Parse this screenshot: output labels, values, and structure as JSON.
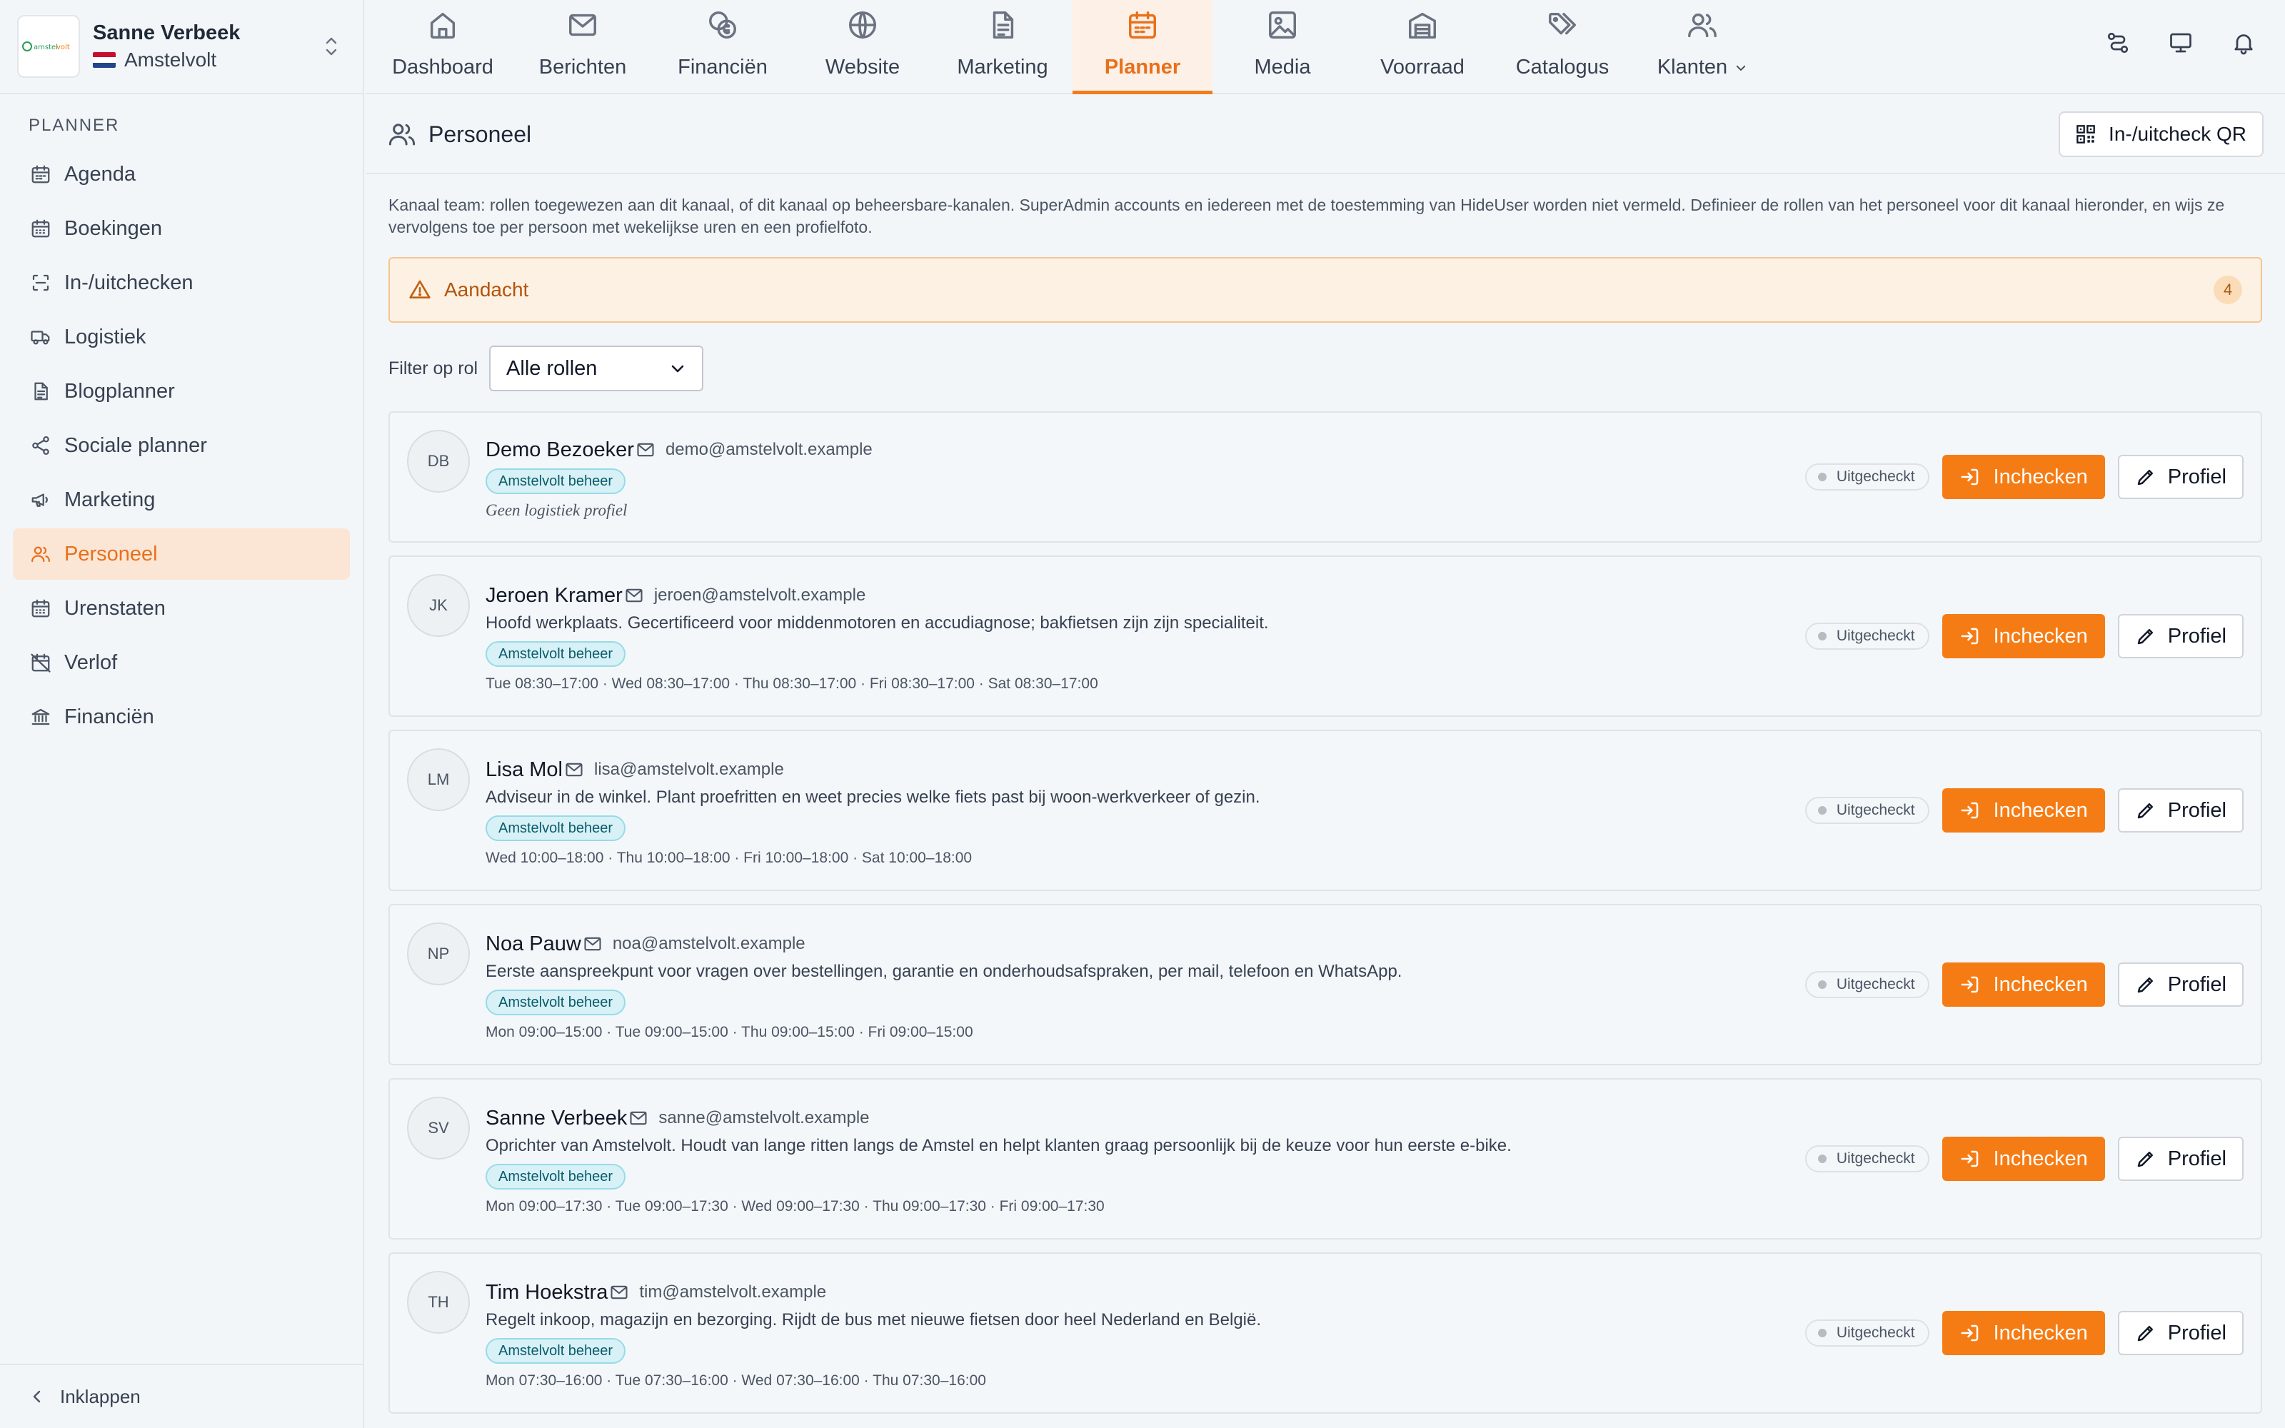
{
  "account": {
    "name": "Sanne Verbeek",
    "channel": "Amstelvolt",
    "logo_text": "amstelvolt"
  },
  "sidebar": {
    "section_title": "PLANNER",
    "items": [
      {
        "label": "Agenda",
        "icon": "calendar-icon"
      },
      {
        "label": "Boekingen",
        "icon": "calendar-grid-icon"
      },
      {
        "label": "In-/uitchecken",
        "icon": "scan-icon"
      },
      {
        "label": "Logistiek",
        "icon": "truck-icon"
      },
      {
        "label": "Blogplanner",
        "icon": "document-icon"
      },
      {
        "label": "Sociale planner",
        "icon": "share-icon"
      },
      {
        "label": "Marketing",
        "icon": "megaphone-icon"
      },
      {
        "label": "Personeel",
        "icon": "users-icon",
        "active": true
      },
      {
        "label": "Urenstaten",
        "icon": "calendar-grid-icon"
      },
      {
        "label": "Verlof",
        "icon": "calendar-off-icon"
      },
      {
        "label": "Financiën",
        "icon": "bank-icon"
      }
    ],
    "collapse_label": "Inklappen"
  },
  "topnav": {
    "tabs": [
      {
        "label": "Dashboard",
        "icon": "home-icon"
      },
      {
        "label": "Berichten",
        "icon": "mail-icon"
      },
      {
        "label": "Financiën",
        "icon": "coins-icon"
      },
      {
        "label": "Website",
        "icon": "globe-icon"
      },
      {
        "label": "Marketing",
        "icon": "document-icon"
      },
      {
        "label": "Planner",
        "icon": "calendar-icon",
        "active": true
      },
      {
        "label": "Media",
        "icon": "image-icon"
      },
      {
        "label": "Voorraad",
        "icon": "warehouse-icon"
      },
      {
        "label": "Catalogus",
        "icon": "tags-icon"
      },
      {
        "label": "Klanten",
        "icon": "users-icon"
      }
    ]
  },
  "page": {
    "title": "Personeel",
    "qr_button": "In-/uitcheck QR",
    "intro": "Kanaal team: rollen toegewezen aan dit kanaal, of dit kanaal op beheersbare-kanalen. SuperAdmin accounts en iedereen met de toestemming van HideUser worden niet vermeld. Definieer de rollen van het personeel voor dit kanaal hieronder, en wijs ze vervolgens toe per persoon met wekelijkse uren en een profielfoto.",
    "attention_label": "Aandacht",
    "attention_count": "4",
    "filter_label": "Filter op rol",
    "filter_value": "Alle rollen"
  },
  "staff_labels": {
    "status": "Uitgecheckt",
    "checkin": "Inchecken",
    "profile": "Profiel"
  },
  "staff": [
    {
      "initials": "DB",
      "name": "Demo Bezoeker",
      "email": "demo@amstelvolt.example",
      "description": "",
      "role": "Amstelvolt beheer",
      "note": "Geen logistiek profiel",
      "hours": ""
    },
    {
      "initials": "JK",
      "name": "Jeroen Kramer",
      "email": "jeroen@amstelvolt.example",
      "description": "Hoofd werkplaats. Gecertificeerd voor middenmotoren en accudiagnose; bakfietsen zijn zijn specialiteit.",
      "role": "Amstelvolt beheer",
      "note": "",
      "hours": "Tue 08:30–17:00 · Wed 08:30–17:00 · Thu 08:30–17:00 · Fri 08:30–17:00 · Sat 08:30–17:00"
    },
    {
      "initials": "LM",
      "name": "Lisa Mol",
      "email": "lisa@amstelvolt.example",
      "description": "Adviseur in de winkel. Plant proefritten en weet precies welke fiets past bij woon-werkverkeer of gezin.",
      "role": "Amstelvolt beheer",
      "note": "",
      "hours": "Wed 10:00–18:00 · Thu 10:00–18:00 · Fri 10:00–18:00 · Sat 10:00–18:00"
    },
    {
      "initials": "NP",
      "name": "Noa Pauw",
      "email": "noa@amstelvolt.example",
      "description": "Eerste aanspreekpunt voor vragen over bestellingen, garantie en onderhoudsafspraken, per mail, telefoon en WhatsApp.",
      "role": "Amstelvolt beheer",
      "note": "",
      "hours": "Mon 09:00–15:00 · Tue 09:00–15:00 · Thu 09:00–15:00 · Fri 09:00–15:00"
    },
    {
      "initials": "SV",
      "name": "Sanne Verbeek",
      "email": "sanne@amstelvolt.example",
      "description": "Oprichter van Amstelvolt. Houdt van lange ritten langs de Amstel en helpt klanten graag persoonlijk bij de keuze voor hun eerste e-bike.",
      "role": "Amstelvolt beheer",
      "note": "",
      "hours": "Mon 09:00–17:30 · Tue 09:00–17:30 · Wed 09:00–17:30 · Thu 09:00–17:30 · Fri 09:00–17:30"
    },
    {
      "initials": "TH",
      "name": "Tim Hoekstra",
      "email": "tim@amstelvolt.example",
      "description": "Regelt inkoop, magazijn en bezorging. Rijdt de bus met nieuwe fietsen door heel Nederland en België.",
      "role": "Amstelvolt beheer",
      "note": "",
      "hours": "Mon 07:30–16:00 · Tue 07:30–16:00 · Wed 07:30–16:00 · Thu 07:30–16:00"
    }
  ],
  "colors": {
    "accent": "#f57c14",
    "accent_text": "#e8701a",
    "attention_bg": "#fdf1e4",
    "badge_bg": "#d7f1f6"
  }
}
